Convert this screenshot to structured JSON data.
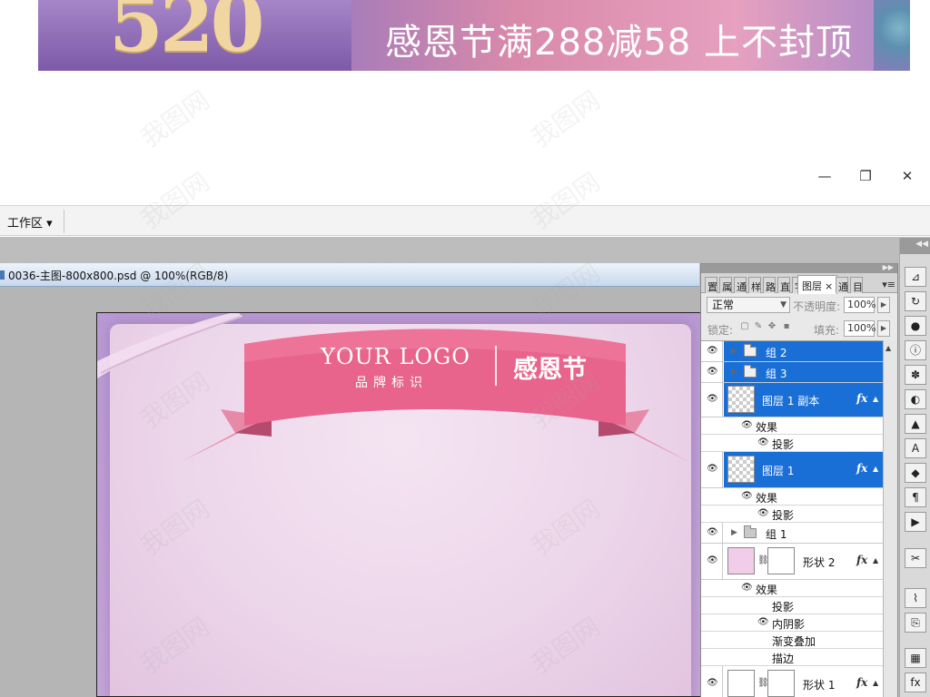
{
  "banner": {
    "number": "520",
    "headline": "感恩节满288减58 上不封顶"
  },
  "window_controls": {
    "minimize": "—",
    "restore": "❐",
    "close": "✕"
  },
  "menubar": {
    "workspace_label": "工作区 ▾"
  },
  "document": {
    "tab_title": "0036-主图-800x800.psd @ 100%(RGB/8)"
  },
  "artwork": {
    "logo": "YOUR LOGO",
    "logo_sub": "品牌标识",
    "ribbon_title": "感恩节",
    "colors": {
      "ribbon": "#e8648c",
      "background": "#ecd6ea",
      "frame": "#b99ad3"
    }
  },
  "watermark_text": "我图网",
  "layers_panel": {
    "tabs": [
      "图层",
      "×"
    ],
    "blend_mode": "正常",
    "opacity_label": "不透明度:",
    "opacity_value": "100%",
    "lock_label": "锁定:",
    "fill_label": "填充:",
    "fill_value": "100%",
    "layers": [
      {
        "name": "组 2",
        "type": "group",
        "selected": true
      },
      {
        "name": "组 3",
        "type": "group",
        "selected": true
      },
      {
        "name": "图层 1 副本",
        "type": "layer",
        "selected": true,
        "fx": "fx",
        "effects_label": "效果",
        "effects": [
          "投影"
        ]
      },
      {
        "name": "图层 1",
        "type": "layer",
        "selected": true,
        "fx": "fx",
        "effects_label": "效果",
        "effects": [
          "投影"
        ]
      },
      {
        "name": "组 1",
        "type": "group",
        "selected": false
      },
      {
        "name": "形状 2",
        "type": "shape",
        "selected": false,
        "fx": "fx",
        "effects_label": "效果",
        "effects": [
          "投影",
          "内阴影",
          "渐变叠加",
          "描边"
        ]
      },
      {
        "name": "形状 1",
        "type": "shape",
        "selected": false,
        "fx": "fx"
      }
    ]
  }
}
